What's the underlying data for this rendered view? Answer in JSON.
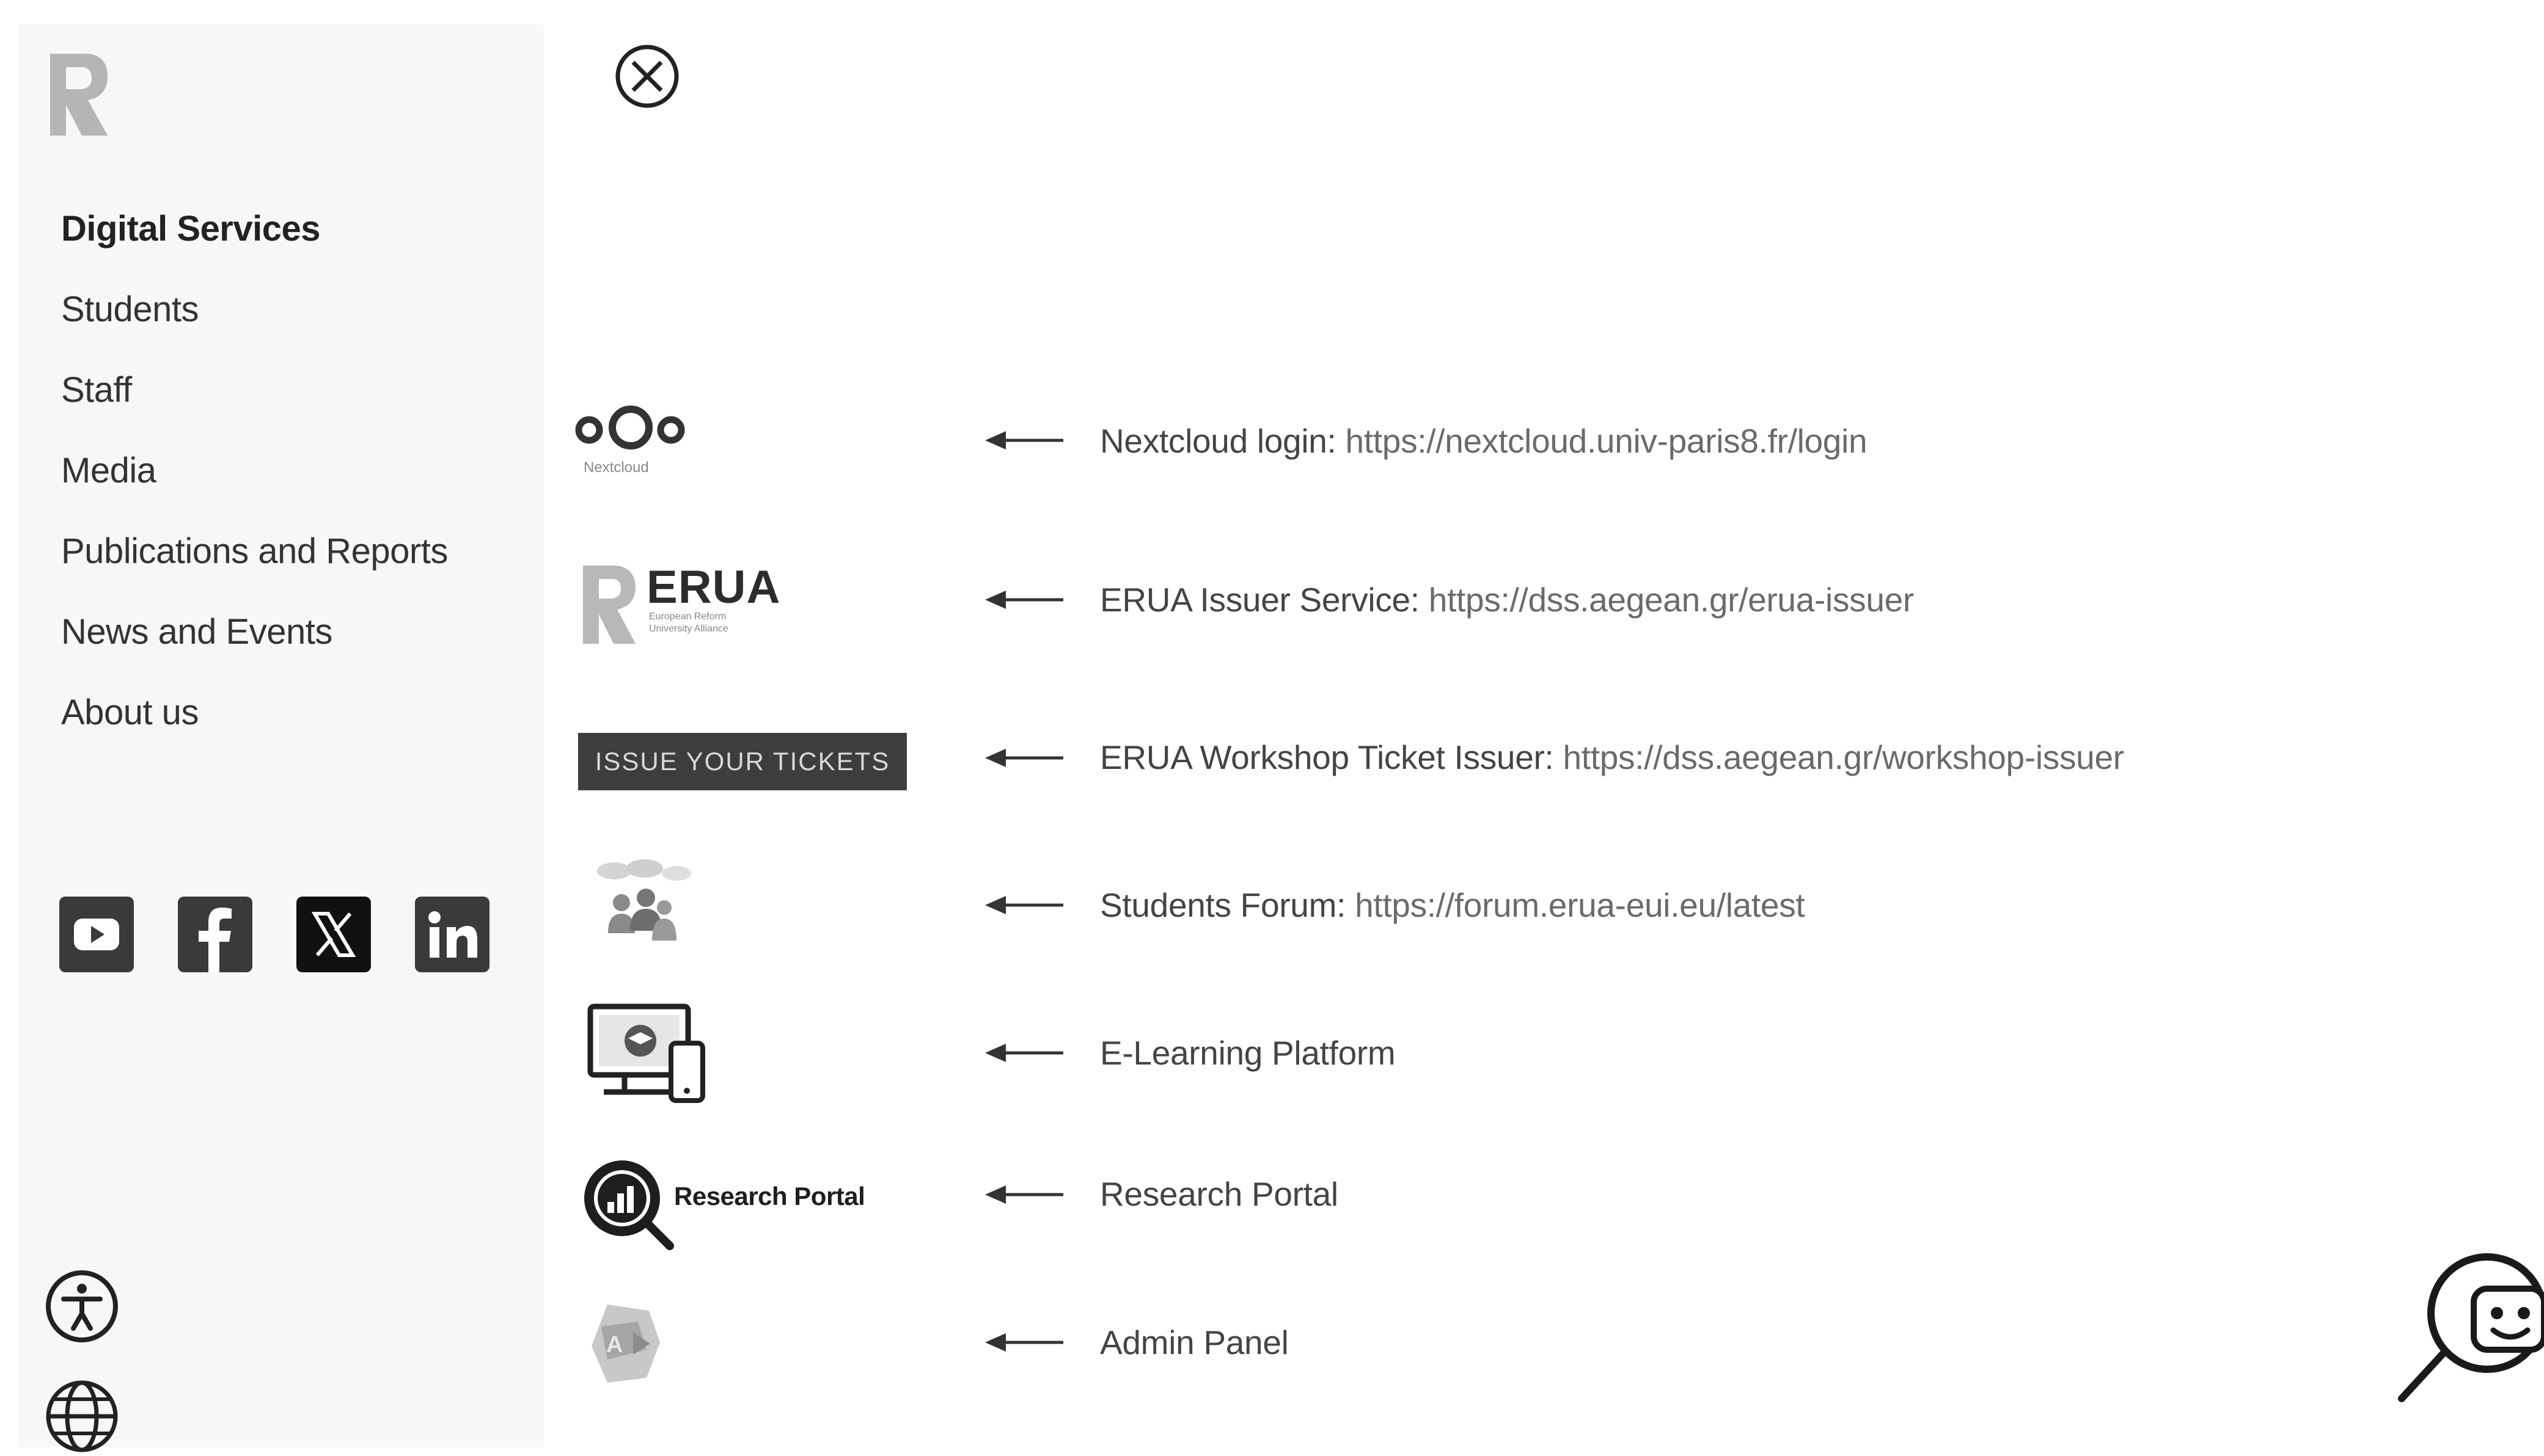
{
  "sidebar": {
    "logo_icon": "erua-r-logo",
    "nav": [
      {
        "label": "Digital Services",
        "active": true
      },
      {
        "label": "Students"
      },
      {
        "label": "Staff"
      },
      {
        "label": "Media"
      },
      {
        "label": "Publications and Reports"
      },
      {
        "label": "News and Events"
      },
      {
        "label": "About us"
      }
    ],
    "socials": [
      "youtube-icon",
      "facebook-icon",
      "x-icon",
      "linkedin-icon"
    ],
    "utility_icons": [
      "accessibility-icon",
      "globe-icon"
    ]
  },
  "close_icon": "close-circle-icon",
  "services": [
    {
      "logo": {
        "icon": "nextcloud-logo-icon",
        "caption": "Nextcloud"
      },
      "name": "Nextcloud login:",
      "url": "https://nextcloud.univ-paris8.fr/login"
    },
    {
      "logo": {
        "icon": "erua-logo-icon",
        "word": "ERUA",
        "subtitle_line1": "European Reform",
        "subtitle_line2": "University Alliance"
      },
      "name": "ERUA Issuer Service:",
      "url": "https://dss.aegean.gr/erua-issuer"
    },
    {
      "logo": {
        "icon": "tickets-button",
        "label": "ISSUE YOUR TICKETS"
      },
      "name": "ERUA Workshop Ticket Issuer:",
      "url": "https://dss.aegean.gr/workshop-issuer"
    },
    {
      "logo": {
        "icon": "forum-people-icon"
      },
      "name": "Students Forum:",
      "url": "https://forum.erua-eui.eu/latest"
    },
    {
      "logo": {
        "icon": "elearning-devices-icon"
      },
      "name": "E-Learning Platform",
      "url": ""
    },
    {
      "logo": {
        "icon": "research-portal-icon",
        "label": "Research Portal"
      },
      "name": "Research Portal",
      "url": ""
    },
    {
      "logo": {
        "icon": "admin-app-icon"
      },
      "name": "Admin Panel",
      "url": ""
    }
  ],
  "chatbot_icon": "chatbot-icon"
}
